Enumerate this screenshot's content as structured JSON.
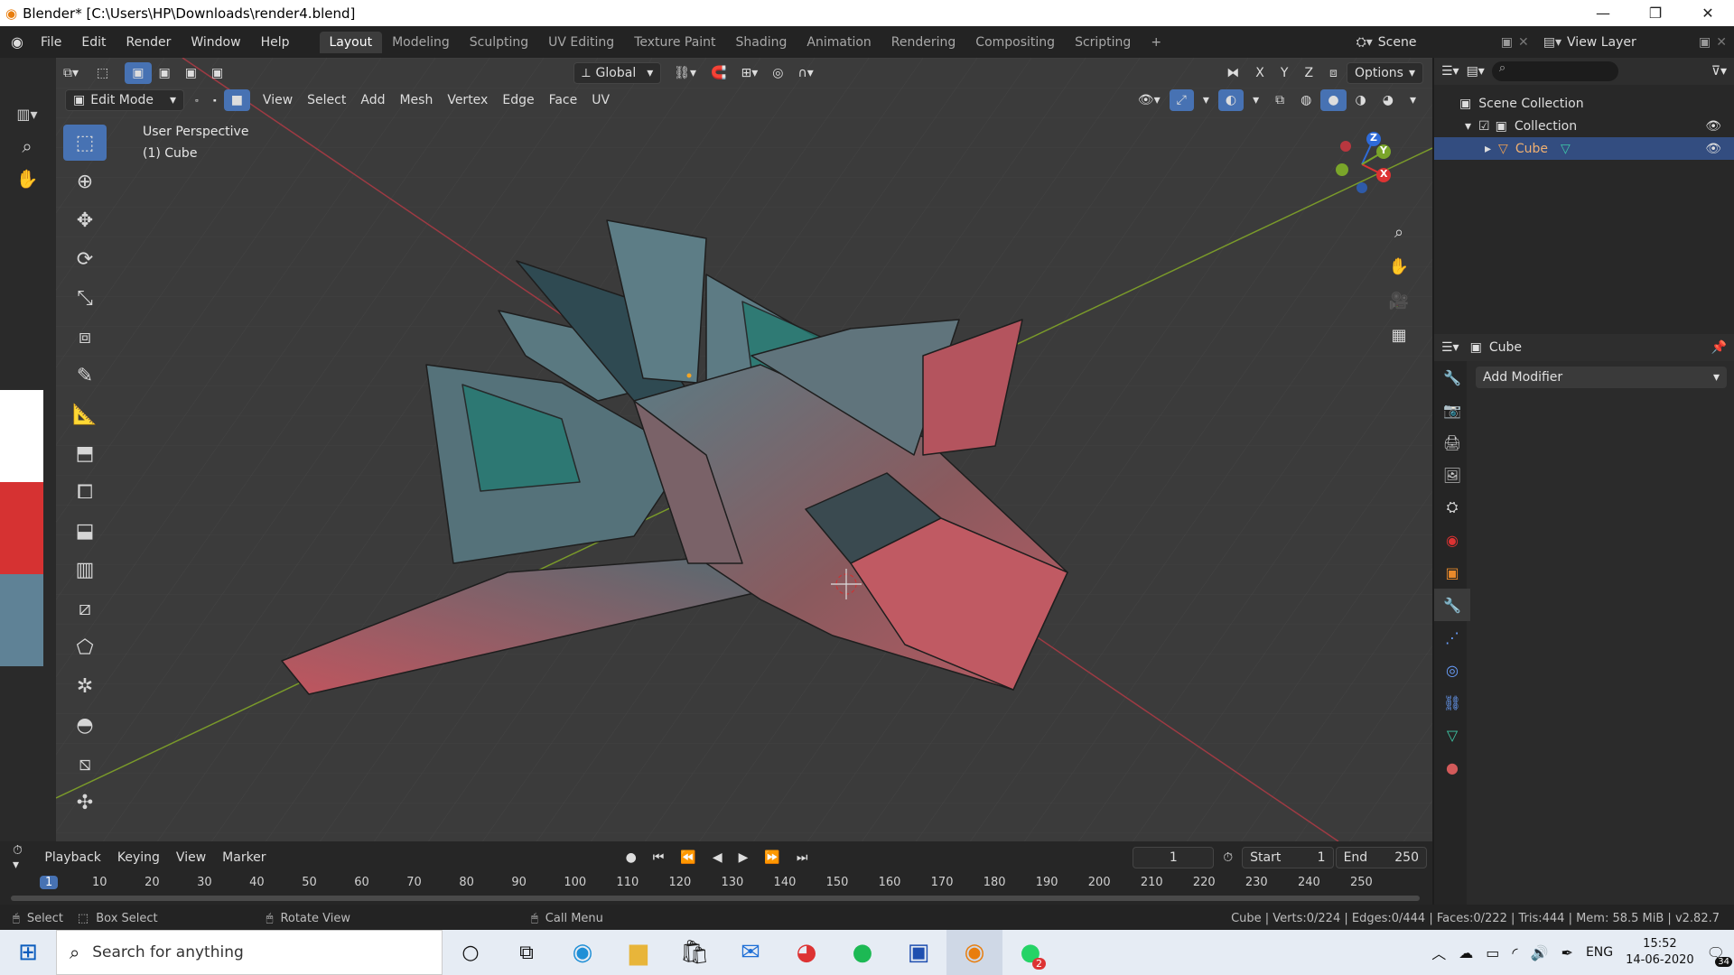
{
  "window": {
    "title": "Blender* [C:\\Users\\HP\\Downloads\\render4.blend]",
    "controls": [
      "—",
      "❐",
      "✕"
    ]
  },
  "menubar": {
    "menus": [
      "File",
      "Edit",
      "Render",
      "Window",
      "Help"
    ],
    "workspaces": [
      "Layout",
      "Modeling",
      "Sculpting",
      "UV Editing",
      "Texture Paint",
      "Shading",
      "Animation",
      "Rendering",
      "Compositing",
      "Scripting"
    ],
    "active_workspace": "Layout",
    "scene": "Scene",
    "view_layer": "View Layer"
  },
  "viewport_header": {
    "orientation": "Global",
    "axes": [
      "X",
      "Y",
      "Z"
    ],
    "options": "Options",
    "mode": "Edit Mode",
    "menus": [
      "View",
      "Select",
      "Add",
      "Mesh",
      "Vertex",
      "Edge",
      "Face",
      "UV"
    ]
  },
  "viewport": {
    "perspective": "User Perspective",
    "object": "(1) Cube"
  },
  "gizmo": {
    "x": "X",
    "y": "Y",
    "z": "Z"
  },
  "outliner": {
    "root": "Scene Collection",
    "collection": "Collection",
    "object": "Cube"
  },
  "properties": {
    "object_name": "Cube",
    "add_modifier": "Add Modifier"
  },
  "timeline": {
    "menus": [
      "Playback",
      "Keying",
      "View",
      "Marker"
    ],
    "current_frame": "1",
    "start_label": "Start",
    "start": "1",
    "end_label": "End",
    "end": "250",
    "ruler": [
      "1",
      "10",
      "20",
      "30",
      "40",
      "50",
      "60",
      "70",
      "80",
      "90",
      "100",
      "110",
      "120",
      "130",
      "140",
      "150",
      "160",
      "170",
      "180",
      "190",
      "200",
      "210",
      "220",
      "230",
      "240",
      "250"
    ]
  },
  "statusbar": {
    "select": "Select",
    "box_select": "Box Select",
    "rotate_view": "Rotate View",
    "call_menu": "Call Menu",
    "stats": "Cube | Verts:0/224 | Edges:0/444 | Faces:0/222 | Tris:444 | Mem: 58.5 MiB | v2.82.7"
  },
  "taskbar": {
    "search_placeholder": "Search for anything",
    "lang": "ENG",
    "time": "15:52",
    "date": "14-06-2020",
    "notif_count": "34",
    "badge": "2"
  },
  "colors": {
    "accent": "#4772b3",
    "viewport": "#3b3b3b",
    "red_axis": "#9e3a43",
    "green_axis": "#7a9a2a"
  }
}
